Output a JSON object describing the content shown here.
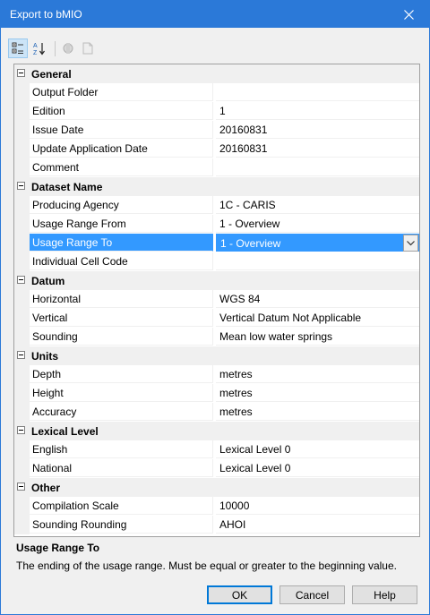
{
  "window": {
    "title": "Export to bMIO"
  },
  "toolbar": {
    "buttons": [
      {
        "name": "categorized-icon",
        "active": true
      },
      {
        "name": "alphabetical-sort-icon",
        "active": false
      },
      {
        "name": "property-pages-icon",
        "active": false
      },
      {
        "name": "events-icon",
        "active": false
      }
    ]
  },
  "grid": {
    "categories": [
      {
        "label": "General",
        "rows": [
          {
            "name": "Output Folder",
            "value": ""
          },
          {
            "name": "Edition",
            "value": "1"
          },
          {
            "name": "Issue Date",
            "value": "20160831"
          },
          {
            "name": "Update Application Date",
            "value": "20160831"
          },
          {
            "name": "Comment",
            "value": ""
          }
        ]
      },
      {
        "label": "Dataset Name",
        "rows": [
          {
            "name": "Producing Agency",
            "value": "1C - CARIS"
          },
          {
            "name": "Usage Range From",
            "value": "1 - Overview"
          },
          {
            "name": "Usage Range To",
            "value": "1 - Overview",
            "selected": true,
            "dropdown": true
          },
          {
            "name": "Individual Cell Code",
            "value": ""
          }
        ]
      },
      {
        "label": "Datum",
        "rows": [
          {
            "name": "Horizontal",
            "value": "WGS 84"
          },
          {
            "name": "Vertical",
            "value": "Vertical Datum Not Applicable"
          },
          {
            "name": "Sounding",
            "value": "Mean low water springs"
          }
        ]
      },
      {
        "label": "Units",
        "rows": [
          {
            "name": "Depth",
            "value": "metres"
          },
          {
            "name": "Height",
            "value": "metres"
          },
          {
            "name": "Accuracy",
            "value": "metres"
          }
        ]
      },
      {
        "label": "Lexical Level",
        "rows": [
          {
            "name": "English",
            "value": "Lexical Level 0"
          },
          {
            "name": "National",
            "value": "Lexical Level 0"
          }
        ]
      },
      {
        "label": "Other",
        "rows": [
          {
            "name": "Compilation Scale",
            "value": "10000"
          },
          {
            "name": "Sounding Rounding",
            "value": "AHOI"
          }
        ]
      }
    ]
  },
  "description": {
    "title": "Usage Range To",
    "text": "The ending of the usage range. Must be equal or greater to the beginning value."
  },
  "buttons": {
    "ok": "OK",
    "cancel": "Cancel",
    "help": "Help"
  }
}
